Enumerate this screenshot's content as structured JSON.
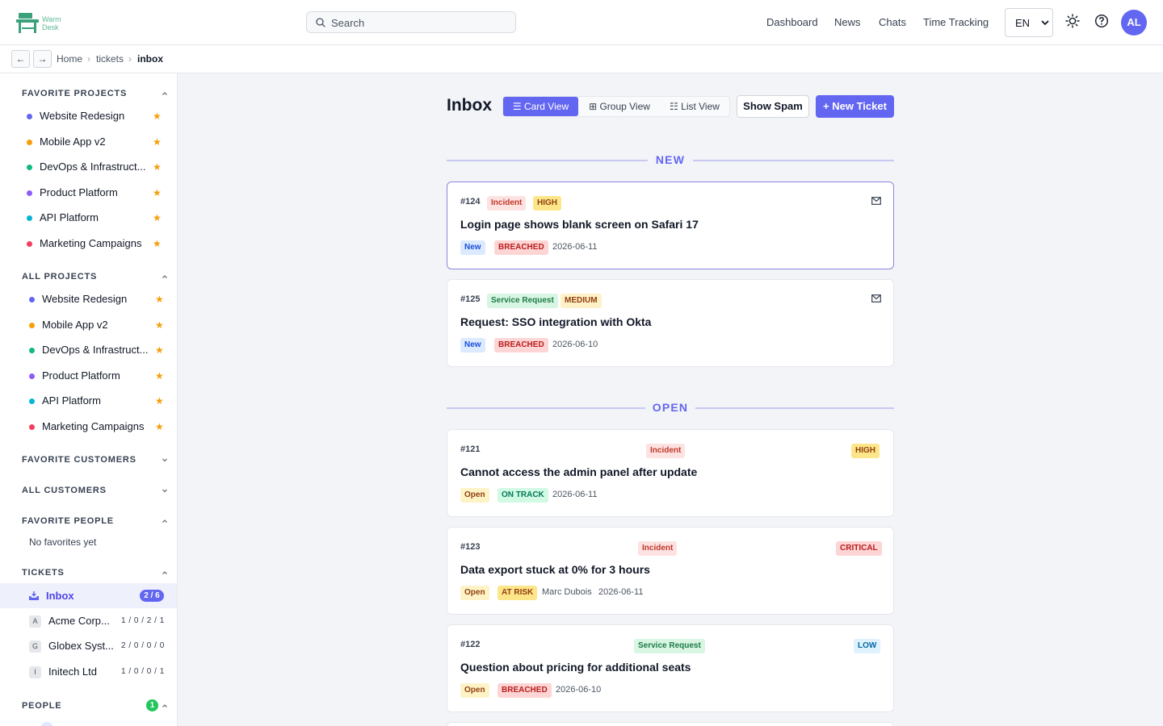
{
  "header": {
    "logo_text_line1": "Warm",
    "logo_text_line2": "Desk",
    "search_placeholder": "Search",
    "nav": [
      "Dashboard",
      "News",
      "Chats",
      "Time Tracking"
    ],
    "language": "EN",
    "avatar_initials": "AL"
  },
  "breadcrumb": {
    "back": "←",
    "forward": "→",
    "items": [
      "Home",
      "tickets",
      "inbox"
    ],
    "separator": "›"
  },
  "sidebar": {
    "favorite_projects": {
      "title": "FAVORITE PROJECTS",
      "items": [
        {
          "label": "Website Redesign",
          "color": "#6366f1"
        },
        {
          "label": "Mobile App v2",
          "color": "#f59e0b"
        },
        {
          "label": "DevOps & Infrastruct...",
          "color": "#10b981"
        },
        {
          "label": "Product Platform",
          "color": "#8b5cf6"
        },
        {
          "label": "API Platform",
          "color": "#06b6d4"
        },
        {
          "label": "Marketing Campaigns",
          "color": "#f43f5e"
        }
      ]
    },
    "all_projects": {
      "title": "ALL PROJECTS",
      "items": [
        {
          "label": "Website Redesign",
          "color": "#6366f1"
        },
        {
          "label": "Mobile App v2",
          "color": "#f59e0b"
        },
        {
          "label": "DevOps & Infrastruct...",
          "color": "#10b981"
        },
        {
          "label": "Product Platform",
          "color": "#8b5cf6"
        },
        {
          "label": "API Platform",
          "color": "#06b6d4"
        },
        {
          "label": "Marketing Campaigns",
          "color": "#f43f5e"
        }
      ]
    },
    "star": "★",
    "favorite_customers_title": "FAVORITE CUSTOMERS",
    "all_customers_title": "ALL CUSTOMERS",
    "favorite_people": {
      "title": "FAVORITE PEOPLE",
      "empty": "No favorites yet"
    },
    "tickets": {
      "title": "TICKETS",
      "inbox_label": "Inbox",
      "inbox_count": "2 / 6",
      "customers": [
        {
          "initial": "A",
          "label": "Acme Corp...",
          "counts": "1 / 0 / 2 / 1"
        },
        {
          "initial": "G",
          "label": "Globex Syst...",
          "counts": "2 / 0 / 0 / 0"
        },
        {
          "initial": "I",
          "label": "Initech Ltd",
          "counts": "1 / 0 / 0 / 1"
        }
      ]
    },
    "people": {
      "title": "PEOPLE",
      "count": "1"
    }
  },
  "main": {
    "title": "Inbox",
    "views": [
      "☰ Card View",
      "⊞ Group View",
      "☷ List View"
    ],
    "active_view": "Card View",
    "show_spam": "Show Spam",
    "new_ticket": "+ New Ticket",
    "groups": [
      {
        "label": "NEW",
        "tickets": [
          {
            "id": "#124",
            "type": "Incident",
            "priority": "HIGH",
            "title": "Login page shows blank screen on Safari 17",
            "status": "New",
            "sla": "BREACHED",
            "assignee": "",
            "date": "2026-06-11",
            "email": true
          },
          {
            "id": "#125",
            "type": "Service Request",
            "priority": "MEDIUM",
            "title": "Request: SSO integration with Okta",
            "status": "New",
            "sla": "BREACHED",
            "assignee": "",
            "date": "2026-06-10",
            "email": true
          }
        ]
      },
      {
        "label": "OPEN",
        "tickets": [
          {
            "id": "#121",
            "type": "Incident",
            "priority": "HIGH",
            "title": "Cannot access the admin panel after update",
            "status": "Open",
            "sla": "ON TRACK",
            "assignee": "",
            "date": "2026-06-11"
          },
          {
            "id": "#123",
            "type": "Incident",
            "priority": "CRITICAL",
            "title": "Data export stuck at 0% for 3 hours",
            "status": "Open",
            "sla": "AT RISK",
            "assignee": "Marc Dubois",
            "date": "2026-06-11"
          },
          {
            "id": "#122",
            "type": "Service Request",
            "priority": "LOW",
            "title": "Question about pricing for additional seats",
            "status": "Open",
            "sla": "BREACHED",
            "assignee": "",
            "date": "2026-06-10"
          }
        ]
      }
    ]
  },
  "colors": {
    "accent": "#6366f1",
    "star": "#f59e0b",
    "people_badge": "#22c55e"
  }
}
